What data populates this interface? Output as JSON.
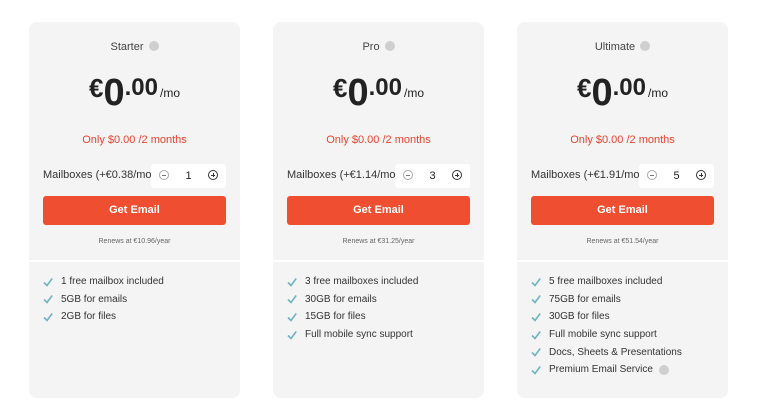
{
  "plans": [
    {
      "name": "Starter",
      "currency": "€",
      "price_whole": "0",
      "price_decimal": ".00",
      "period": "/mo",
      "promo": "Only $0.00 /2 months",
      "mailbox_label": "Mailboxes (+€0.38/mo)",
      "quantity": "1",
      "cta": "Get Email",
      "renews": "Renews at €10.96/year",
      "features": [
        "1 free mailbox included",
        "5GB for emails",
        "2GB for files"
      ]
    },
    {
      "name": "Pro",
      "currency": "€",
      "price_whole": "0",
      "price_decimal": ".00",
      "period": "/mo",
      "promo": "Only $0.00 /2 months",
      "mailbox_label": "Mailboxes (+€1.14/mo)",
      "quantity": "3",
      "cta": "Get Email",
      "renews": "Renews at €31.25/year",
      "features": [
        "3 free mailboxes included",
        "30GB for emails",
        "15GB for files",
        "Full mobile sync support"
      ]
    },
    {
      "name": "Ultimate",
      "currency": "€",
      "price_whole": "0",
      "price_decimal": ".00",
      "period": "/mo",
      "promo": "Only $0.00 /2 months",
      "mailbox_label": "Mailboxes (+€1.91/mo)",
      "quantity": "5",
      "cta": "Get Email",
      "renews": "Renews at €51.54/year",
      "features": [
        "5 free mailboxes included",
        "75GB for emails",
        "30GB for files",
        "Full mobile sync support",
        "Docs, Sheets & Presentations",
        "Premium Email Service"
      ]
    }
  ],
  "icons": {
    "info": "info-icon",
    "check": "check-icon",
    "minus": "minus-circle-icon",
    "plus": "plus-circle-icon"
  },
  "colors": {
    "accent": "#f04e30",
    "promo": "#e8432d",
    "check": "#6fb3c0",
    "card_bg": "#f4f4f4"
  }
}
